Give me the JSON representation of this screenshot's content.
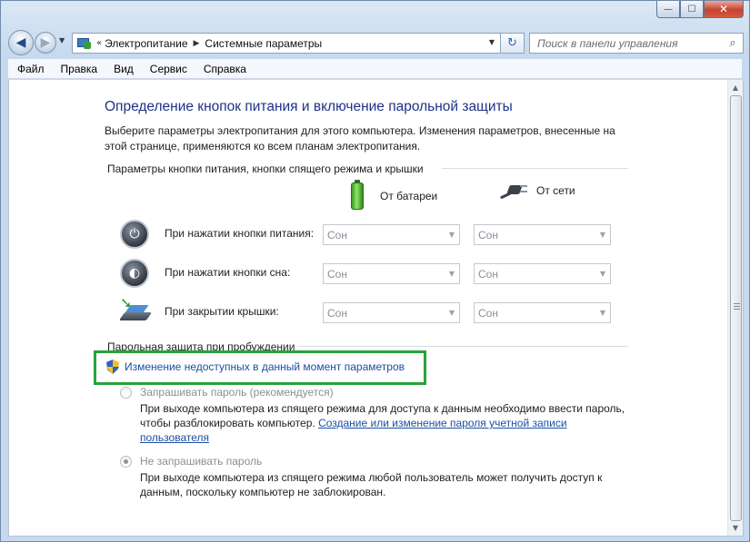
{
  "window": {
    "caption": {
      "minimize": "—",
      "maximize": "☐",
      "close": "✕"
    }
  },
  "nav": {
    "back": "◀",
    "forward": "▶",
    "history": "▼"
  },
  "address": {
    "prefix": "«",
    "breadcrumbs": [
      "Электропитание",
      "Системные параметры"
    ],
    "separator": "▶",
    "dropdown": "▼"
  },
  "refresh": "↻",
  "search": {
    "placeholder": "Поиск в панели управления",
    "icon": "⌕"
  },
  "menu": [
    "Файл",
    "Правка",
    "Вид",
    "Сервис",
    "Справка"
  ],
  "page": {
    "title": "Определение кнопок питания и включение парольной защиты",
    "description": "Выберите параметры электропитания для этого компьютера. Изменения параметров, внесенные на этой странице, применяются ко всем планам электропитания.",
    "buttons_group": "Параметры кнопки питания, кнопки спящего режима и крышки",
    "columns": {
      "battery": "От батареи",
      "plugged": "От сети"
    },
    "rows": [
      {
        "label": "При нажатии кнопки питания:",
        "battery": "Сон",
        "plugged": "Сон",
        "icon": "power-button-icon"
      },
      {
        "label": "При нажатии кнопки сна:",
        "battery": "Сон",
        "plugged": "Сон",
        "icon": "sleep-button-icon"
      },
      {
        "label": "При закрытии крышки:",
        "battery": "Сон",
        "plugged": "Сон",
        "icon": "laptop-lid-icon"
      }
    ],
    "password_group": "Парольная защита при пробуждении",
    "change_link": "Изменение недоступных в данный момент параметров",
    "options": [
      {
        "label": "Запрашивать пароль (рекомендуется)",
        "checked": false,
        "desc": "При выходе компьютера из спящего режима для доступа к данным необходимо ввести пароль, чтобы разблокировать компьютер.",
        "link": "Создание или изменение пароля учетной записи пользователя"
      },
      {
        "label": "Не запрашивать пароль",
        "checked": true,
        "desc": "При выходе компьютера из спящего режима любой пользователь может получить доступ к данным, поскольку компьютер не заблокирован.",
        "link": ""
      }
    ]
  },
  "colors": {
    "accent_highlight": "#27a33b",
    "title": "#1e3287",
    "link": "#1a4fa3"
  }
}
